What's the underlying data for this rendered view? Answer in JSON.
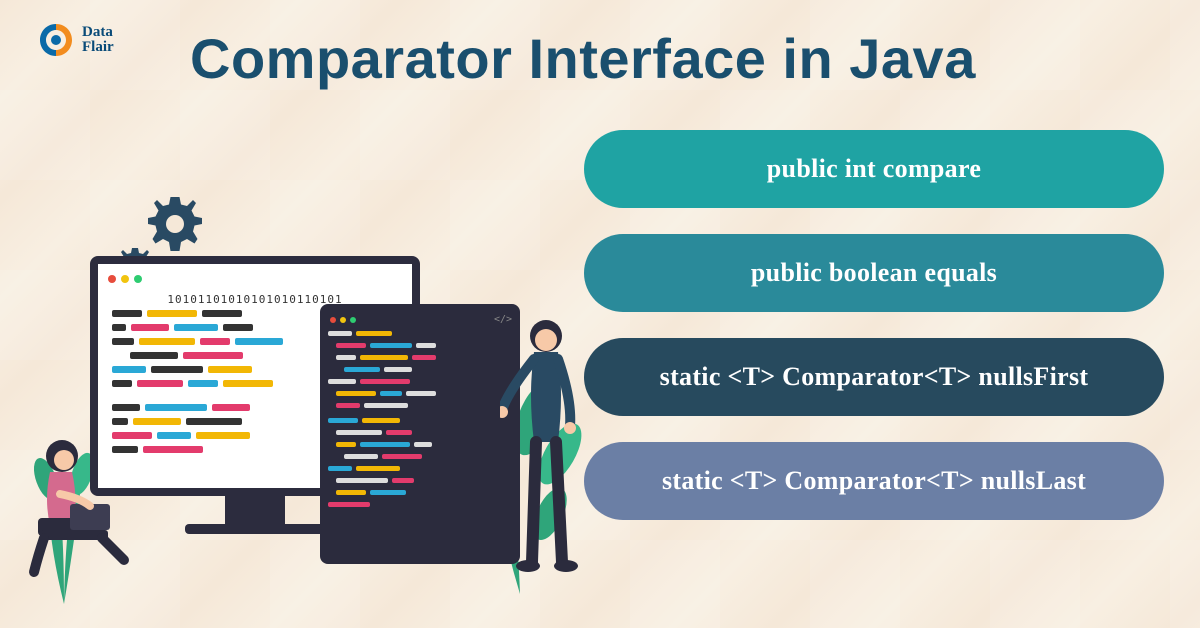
{
  "logo": {
    "line1": "Data",
    "line2": "Flair"
  },
  "title": "Comparator Interface in Java",
  "pills": [
    {
      "label": "public int compare",
      "color": "#1fa3a3"
    },
    {
      "label": "public boolean equals",
      "color": "#2a8a9a"
    },
    {
      "label": "static <T> Comparator<T> nullsFirst",
      "color": "#274a5e"
    },
    {
      "label": "static <T> Comparator<T> nullsLast",
      "color": "#6b7fa5"
    }
  ],
  "illustration": {
    "monitor_binary": "1010110101010101011010­1",
    "editor_tag": "</>"
  }
}
